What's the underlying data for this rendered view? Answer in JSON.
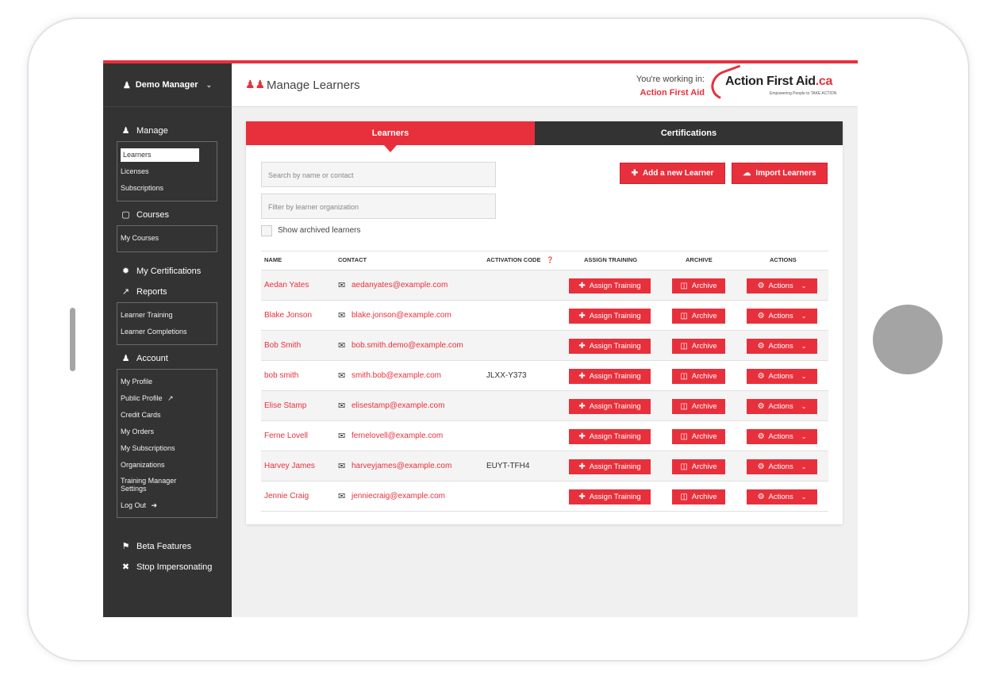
{
  "user_menu": {
    "name": "Demo Manager"
  },
  "sidebar": {
    "manage": {
      "label": "Manage",
      "items": [
        "Learners",
        "Licenses",
        "Subscriptions"
      ]
    },
    "courses": {
      "label": "Courses",
      "items": [
        "My Courses"
      ]
    },
    "my_certifications": "My Certifications",
    "reports": {
      "label": "Reports",
      "items": [
        "Learner Training",
        "Learner Completions"
      ]
    },
    "account": {
      "label": "Account",
      "items": [
        "My Profile",
        "Public Profile",
        "Credit Cards",
        "My Orders",
        "My Subscriptions",
        "Organizations",
        "Training Manager Settings",
        "Log Out"
      ]
    },
    "beta_features": "Beta Features",
    "stop_impersonating": "Stop Impersonating"
  },
  "header": {
    "title": "Manage Learners",
    "working_in_label": "You're working in:",
    "organization": "Action First Aid",
    "logo_text": "Action First Aid",
    "logo_suffix": ".ca",
    "logo_tagline": "Empowering People to TAKE ACTION"
  },
  "tabs": [
    "Learners",
    "Certifications"
  ],
  "filters": {
    "search_placeholder": "Search by name or contact",
    "org_placeholder": "Filter by learner organization",
    "show_archived": "Show archived learners"
  },
  "buttons": {
    "add": "Add a new Learner",
    "import": "Import Learners"
  },
  "table": {
    "headers": [
      "NAME",
      "CONTACT",
      "ACTIVATION CODE",
      "ASSIGN TRAINING",
      "ARCHIVE",
      "ACTIONS"
    ],
    "row_buttons": {
      "assign": "Assign Training",
      "archive": "Archive",
      "actions": "Actions"
    },
    "rows": [
      {
        "name": "Aedan Yates",
        "email": "aedanyates@example.com",
        "code": ""
      },
      {
        "name": "Blake Jonson",
        "email": "blake.jonson@example.com",
        "code": ""
      },
      {
        "name": "Bob Smith",
        "email": "bob.smith.demo@example.com",
        "code": ""
      },
      {
        "name": "bob smith",
        "email": "smith.bob@example.com",
        "code": "JLXX-Y373"
      },
      {
        "name": "Elise Stamp",
        "email": "elisestamp@example.com",
        "code": ""
      },
      {
        "name": "Ferne Lovell",
        "email": "fernelovell@example.com",
        "code": ""
      },
      {
        "name": "Harvey James",
        "email": "harveyjames@example.com",
        "code": "EUYT-TFH4"
      },
      {
        "name": "Jennie Craig",
        "email": "jenniecraig@example.com",
        "code": ""
      }
    ]
  },
  "colors": {
    "accent": "#e8303c",
    "sidebar": "#333333",
    "background": "#f0f0f0"
  }
}
